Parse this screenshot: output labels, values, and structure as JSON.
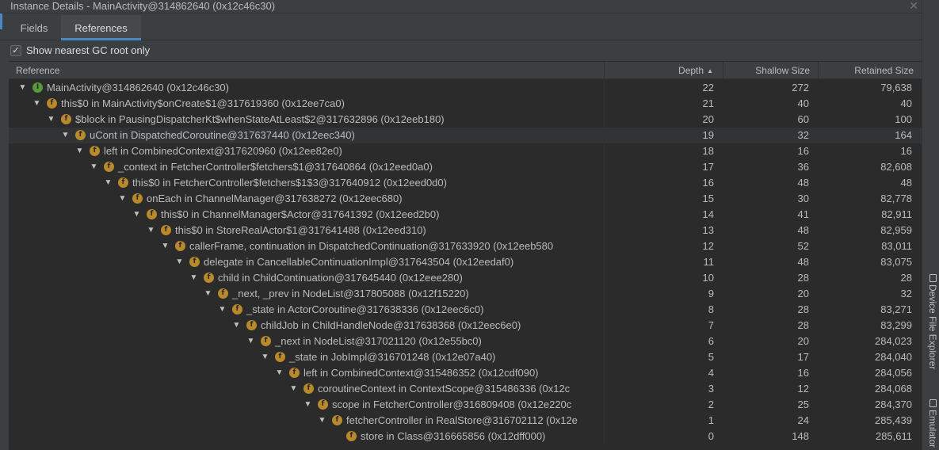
{
  "window": {
    "title": "Instance Details - MainActivity@314862640 (0x12c46c30)",
    "close_glyph": "✕"
  },
  "tabs": [
    {
      "label": "Fields"
    },
    {
      "label": "References",
      "active": true
    }
  ],
  "gc_filter": {
    "checked": true,
    "check_glyph": "✓",
    "label": "Show nearest GC root only"
  },
  "table": {
    "columns": {
      "reference": "Reference",
      "depth": "Depth",
      "shallow": "Shallow Size",
      "retained": "Retained Size"
    },
    "sort": {
      "column": "depth",
      "direction": "ascending",
      "glyph": "▲"
    },
    "rows": [
      {
        "icon": "instance",
        "icon_letter": "I",
        "text": "MainActivity@314862640 (0x12c46c30)",
        "depth": "22",
        "shallow": "272",
        "retained": "79,638"
      },
      {
        "icon": "field",
        "icon_letter": "f",
        "text": "this$0 in MainActivity$onCreate$1@317619360 (0x12ee7ca0)",
        "depth": "21",
        "shallow": "40",
        "retained": "40"
      },
      {
        "icon": "field",
        "icon_letter": "f",
        "text": "$block in PausingDispatcherKt$whenStateAtLeast$2@317632896 (0x12eeb180)",
        "depth": "20",
        "shallow": "60",
        "retained": "100"
      },
      {
        "icon": "field",
        "icon_letter": "f",
        "text": "uCont in DispatchedCoroutine@317637440 (0x12eec340)",
        "depth": "19",
        "shallow": "32",
        "retained": "164",
        "selected": true
      },
      {
        "icon": "field",
        "icon_letter": "f",
        "text": "left in CombinedContext@317620960 (0x12ee82e0)",
        "depth": "18",
        "shallow": "16",
        "retained": "16"
      },
      {
        "icon": "field",
        "icon_letter": "f",
        "text": "_context in FetcherController$fetchers$1@317640864 (0x12eed0a0)",
        "depth": "17",
        "shallow": "36",
        "retained": "82,608"
      },
      {
        "icon": "field",
        "icon_letter": "f",
        "text": "this$0 in FetcherController$fetchers$1$3@317640912 (0x12eed0d0)",
        "depth": "16",
        "shallow": "48",
        "retained": "48"
      },
      {
        "icon": "field",
        "icon_letter": "f",
        "text": "onEach in ChannelManager@317638272 (0x12eec680)",
        "depth": "15",
        "shallow": "30",
        "retained": "82,778"
      },
      {
        "icon": "field",
        "icon_letter": "f",
        "text": "this$0 in ChannelManager$Actor@317641392 (0x12eed2b0)",
        "depth": "14",
        "shallow": "41",
        "retained": "82,911"
      },
      {
        "icon": "field",
        "icon_letter": "f",
        "text": "this$0 in StoreRealActor$1@317641488 (0x12eed310)",
        "depth": "13",
        "shallow": "48",
        "retained": "82,959"
      },
      {
        "icon": "field",
        "icon_letter": "f",
        "text": "callerFrame, continuation in DispatchedContinuation@317633920 (0x12eeb580",
        "depth": "12",
        "shallow": "52",
        "retained": "83,011"
      },
      {
        "icon": "field",
        "icon_letter": "f",
        "text": "delegate in CancellableContinuationImpl@317643504 (0x12eedaf0)",
        "depth": "11",
        "shallow": "48",
        "retained": "83,075"
      },
      {
        "icon": "field",
        "icon_letter": "f",
        "text": "child in ChildContinuation@317645440 (0x12eee280)",
        "depth": "10",
        "shallow": "28",
        "retained": "28"
      },
      {
        "icon": "field",
        "icon_letter": "f",
        "text": "_next, _prev in NodeList@317805088 (0x12f15220)",
        "depth": "9",
        "shallow": "20",
        "retained": "32"
      },
      {
        "icon": "field",
        "icon_letter": "f",
        "text": "_state in ActorCoroutine@317638336 (0x12eec6c0)",
        "depth": "8",
        "shallow": "28",
        "retained": "83,271"
      },
      {
        "icon": "field",
        "icon_letter": "f",
        "text": "childJob in ChildHandleNode@317638368 (0x12eec6e0)",
        "depth": "7",
        "shallow": "28",
        "retained": "83,299"
      },
      {
        "icon": "field",
        "icon_letter": "f",
        "text": "_next in NodeList@317021120 (0x12e55bc0)",
        "depth": "6",
        "shallow": "20",
        "retained": "284,023"
      },
      {
        "icon": "field",
        "icon_letter": "f",
        "text": "_state in JobImpl@316701248 (0x12e07a40)",
        "depth": "5",
        "shallow": "17",
        "retained": "284,040"
      },
      {
        "icon": "field",
        "icon_letter": "f",
        "text": "left in CombinedContext@315486352 (0x12cdf090)",
        "depth": "4",
        "shallow": "16",
        "retained": "284,056"
      },
      {
        "icon": "field",
        "icon_letter": "f",
        "text": "coroutineContext in ContextScope@315486336 (0x12c",
        "depth": "3",
        "shallow": "12",
        "retained": "284,068"
      },
      {
        "icon": "field",
        "icon_letter": "f",
        "text": "scope in FetcherController@316809408 (0x12e220c",
        "depth": "2",
        "shallow": "25",
        "retained": "284,370"
      },
      {
        "icon": "field",
        "icon_letter": "f",
        "text": "fetcherController in RealStore@316702112 (0x12e",
        "depth": "1",
        "shallow": "24",
        "retained": "285,439"
      },
      {
        "icon": "field",
        "icon_letter": "f",
        "text": "store in Class@316665856 (0x12dff000)",
        "depth": "0",
        "shallow": "148",
        "retained": "285,611",
        "leaf": true
      }
    ]
  },
  "sidebar": {
    "tabs": [
      {
        "label": "Device File Explorer"
      },
      {
        "label": "Emulator"
      }
    ]
  }
}
